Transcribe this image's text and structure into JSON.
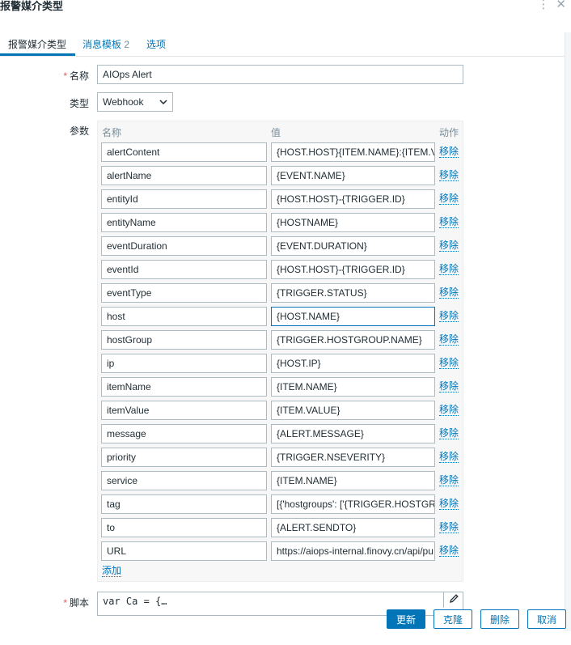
{
  "dialog": {
    "title": "报警媒介类型"
  },
  "tabs": [
    {
      "label": "报警媒介类型"
    },
    {
      "label": "消息模板",
      "count": "2"
    },
    {
      "label": "选项"
    }
  ],
  "form": {
    "name_label": "名称",
    "name_value": "AIOps Alert",
    "type_label": "类型",
    "type_value": "Webhook",
    "params_label": "参数",
    "script_label": "脚本",
    "script_value": "var Ca = {…"
  },
  "params": {
    "headers": {
      "name": "名称",
      "value": "值",
      "action": "动作"
    },
    "remove_label": "移除",
    "add_label": "添加",
    "rows": [
      {
        "name": "alertContent",
        "value": "{HOST.HOST}{ITEM.NAME}:{ITEM.VALUE}"
      },
      {
        "name": "alertName",
        "value": "{EVENT.NAME}"
      },
      {
        "name": "entityId",
        "value": "{HOST.HOST}-{TRIGGER.ID}"
      },
      {
        "name": "entityName",
        "value": "{HOSTNAME}"
      },
      {
        "name": "eventDuration",
        "value": "{EVENT.DURATION}"
      },
      {
        "name": "eventId",
        "value": "{HOST.HOST}-{TRIGGER.ID}"
      },
      {
        "name": "eventType",
        "value": "{TRIGGER.STATUS}"
      },
      {
        "name": "host",
        "value": "{HOST.NAME}"
      },
      {
        "name": "hostGroup",
        "value": "{TRIGGER.HOSTGROUP.NAME}"
      },
      {
        "name": "ip",
        "value": "{HOST.IP}"
      },
      {
        "name": "itemName",
        "value": "{ITEM.NAME}"
      },
      {
        "name": "itemValue",
        "value": "{ITEM.VALUE}"
      },
      {
        "name": "message",
        "value": "{ALERT.MESSAGE}"
      },
      {
        "name": "priority",
        "value": "{TRIGGER.NSEVERITY}"
      },
      {
        "name": "service",
        "value": "{ITEM.NAME}"
      },
      {
        "name": "tag",
        "value": "[{'hostgroups': ['{TRIGGER.HOSTGROUP.NAME}']}]"
      },
      {
        "name": "to",
        "value": "{ALERT.SENDTO}"
      },
      {
        "name": "URL",
        "value": "https://aiops-internal.finovy.cn/api/pu"
      }
    ]
  },
  "buttons": {
    "update": "更新",
    "clone": "克隆",
    "delete": "删除",
    "cancel": "取消"
  },
  "colors": {
    "accent": "#0275b8",
    "required": "#e45959"
  }
}
